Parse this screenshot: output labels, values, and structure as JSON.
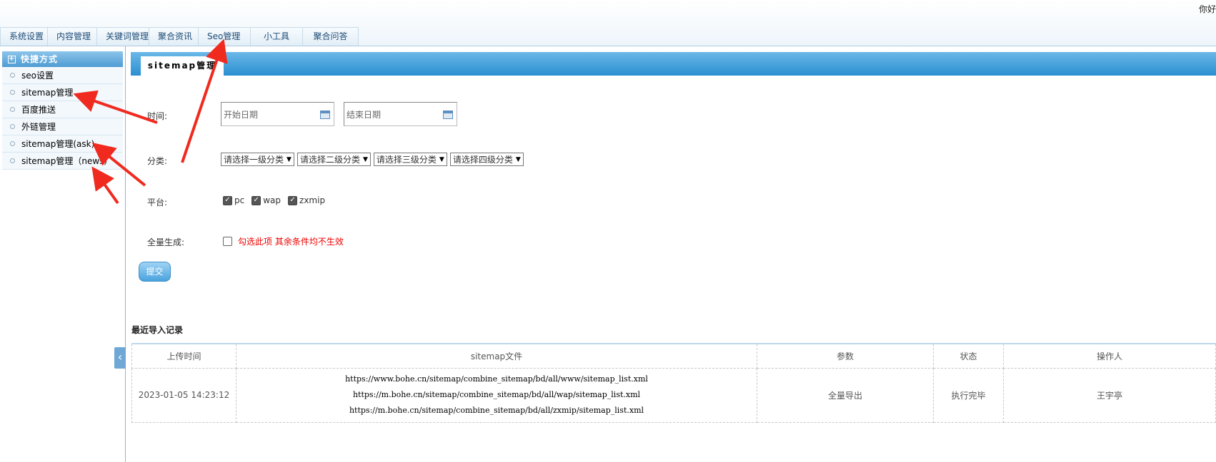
{
  "header": {
    "greeting": "你好",
    "tabs": [
      "系统设置",
      "内容管理",
      "关键词管理",
      "聚合资讯",
      "Seo管理",
      "小工具",
      "聚合问答"
    ]
  },
  "sidebar": {
    "title": "快捷方式",
    "items": [
      "seo设置",
      "sitemap管理",
      "百度推送",
      "外链管理",
      "sitemap管理(ask)",
      "sitemap管理（news）"
    ]
  },
  "content": {
    "tab_title": "sitemap管理",
    "form": {
      "time_label": "时间:",
      "start_placeholder": "开始日期",
      "end_placeholder": "结束日期",
      "category_label": "分类:",
      "category_selects": [
        "请选择一级分类",
        "请选择二级分类",
        "请选择三级分类",
        "请选择四级分类"
      ],
      "platform_label": "平台:",
      "platforms": [
        {
          "label": "pc",
          "checked": true
        },
        {
          "label": "wap",
          "checked": true
        },
        {
          "label": "zxmip",
          "checked": true
        }
      ],
      "full_label": "全量生成:",
      "full_checked": false,
      "full_hint": "勾选此项 其余条件均不生效",
      "submit": "提交"
    },
    "records": {
      "title": "最近导入记录",
      "columns": [
        "上传时间",
        "sitemap文件",
        "参数",
        "状态",
        "操作人"
      ],
      "rows": [
        {
          "time": "2023-01-05 14:23:12",
          "files": [
            "https://www.bohe.cn/sitemap/combine_sitemap/bd/all/www/sitemap_list.xml",
            "https://m.bohe.cn/sitemap/combine_sitemap/bd/all/wap/sitemap_list.xml",
            "https://m.bohe.cn/sitemap/combine_sitemap/bd/all/zxmip/sitemap_list.xml"
          ],
          "param": "全量导出",
          "status": "执行完毕",
          "operator": "王宇亭"
        }
      ]
    }
  },
  "colors": {
    "accent_blue": "#2a8fd0",
    "annotation_arrow": "#f02a1f",
    "warning_text": "#e00000"
  }
}
